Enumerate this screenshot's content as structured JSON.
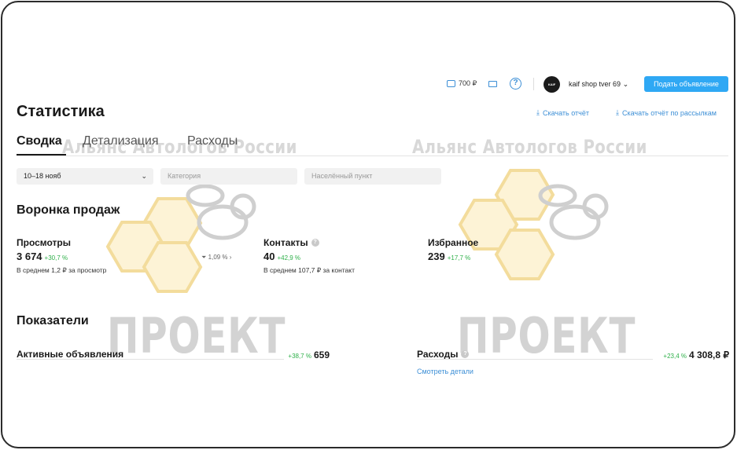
{
  "watermarks": {
    "association": "Альянс Автологов России",
    "project": "ПРОЕКТ"
  },
  "header": {
    "balance": "700 ₽",
    "avatar_text": "KAIF SHOP",
    "shop_name": "kaif shop tver 69",
    "post_ad_label": "Подать объявление"
  },
  "page": {
    "title": "Статистика",
    "download_report": "Скачать отчёт",
    "download_mailing_report": "Скачать отчёт по рассылкам"
  },
  "tabs": [
    {
      "label": "Сводка",
      "active": true
    },
    {
      "label": "Детализация",
      "active": false
    },
    {
      "label": "Расходы",
      "active": false
    }
  ],
  "filters": {
    "date": "10–18 нояб",
    "category_placeholder": "Категория",
    "location_placeholder": "Населённый пункт"
  },
  "funnel": {
    "title": "Воронка продаж",
    "views": {
      "label": "Просмотры",
      "value": "3 674",
      "delta": "+30,7 %",
      "note": "В среднем 1,2 ₽ за просмотр"
    },
    "conversion": "1,09 %",
    "contacts": {
      "label": "Контакты",
      "value": "40",
      "delta": "+42,9 %",
      "note": "В среднем 107,7 ₽ за контакт"
    },
    "favorites": {
      "label": "Избранное",
      "value": "239",
      "delta": "+17,7 %"
    }
  },
  "indicators": {
    "title": "Показатели",
    "active_ads": {
      "label": "Активные объявления",
      "delta": "+38,7 %",
      "value": "659"
    },
    "expenses": {
      "label": "Расходы",
      "delta": "+23,4 %",
      "value": "4 308,8 ₽",
      "link": "Смотреть детали"
    }
  },
  "colors": {
    "accent": "#2fa8f4",
    "link": "#3d8fd6",
    "positive": "#2fb04a",
    "honeycomb_fill": "#fdf3d6",
    "honeycomb_stroke": "#f3dc9c"
  }
}
